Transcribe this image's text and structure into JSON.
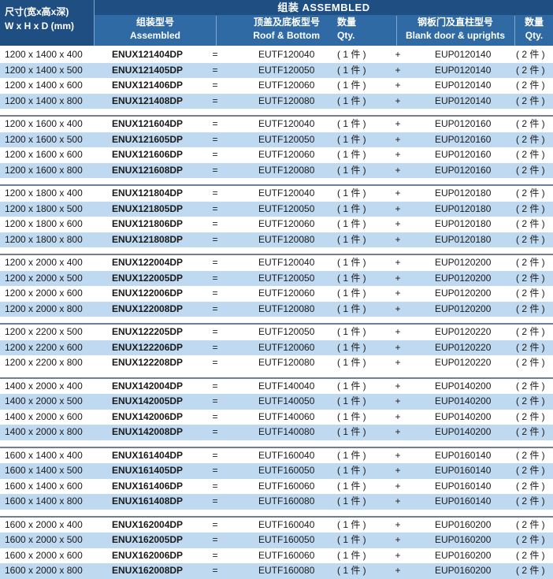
{
  "header": {
    "size_zh": "尺寸(宽x高x深)",
    "size_en": "W x H x D (mm)",
    "assembled": "组装  ASSEMBLED",
    "model_zh": "组装型号",
    "model_en": "Assembled",
    "roof_zh": "顶盖及底板型号",
    "roof_en": "Roof & Bottom",
    "qty1_zh": "数量",
    "qty1_en": "Qty.",
    "blank_zh": "钢板门及直柱型号",
    "blank_en": "Blank door & uprights",
    "qty2_zh": "数量",
    "qty2_en": "Qty."
  },
  "symbols": {
    "equals": "=",
    "plus": "+",
    "qty_one": "( 1 件 )",
    "qty_two": "( 2 件 )"
  },
  "colors": {
    "header_dark": "#1f4f82",
    "header_light": "#2f6aa5",
    "row_alt": "#bfd9f0",
    "group_rule": "#6f7f91"
  },
  "groups": [
    [
      {
        "size": "1200 x 1400 x 400",
        "model": "ENUX121404DP",
        "roof": "EUTF120040",
        "blank": "EUP0120140"
      },
      {
        "size": "1200 x 1400 x 500",
        "model": "ENUX121405DP",
        "roof": "EUTF120050",
        "blank": "EUP0120140"
      },
      {
        "size": "1200 x 1400 x 600",
        "model": "ENUX121406DP",
        "roof": "EUTF120060",
        "blank": "EUP0120140"
      },
      {
        "size": "1200 x 1400 x 800",
        "model": "ENUX121408DP",
        "roof": "EUTF120080",
        "blank": "EUP0120140"
      }
    ],
    [
      {
        "size": "1200 x 1600 x 400",
        "model": "ENUX121604DP",
        "roof": "EUTF120040",
        "blank": "EUP0120160"
      },
      {
        "size": "1200 x 1600 x 500",
        "model": "ENUX121605DP",
        "roof": "EUTF120050",
        "blank": "EUP0120160"
      },
      {
        "size": "1200 x 1600 x 600",
        "model": "ENUX121606DP",
        "roof": "EUTF120060",
        "blank": "EUP0120160"
      },
      {
        "size": "1200 x 1600 x 800",
        "model": "ENUX121608DP",
        "roof": "EUTF120080",
        "blank": "EUP0120160"
      }
    ],
    [
      {
        "size": "1200 x 1800 x 400",
        "model": "ENUX121804DP",
        "roof": "EUTF120040",
        "blank": "EUP0120180"
      },
      {
        "size": "1200 x 1800 x 500",
        "model": "ENUX121805DP",
        "roof": "EUTF120050",
        "blank": "EUP0120180"
      },
      {
        "size": "1200 x 1800 x 600",
        "model": "ENUX121806DP",
        "roof": "EUTF120060",
        "blank": "EUP0120180"
      },
      {
        "size": "1200 x 1800 x 800",
        "model": "ENUX121808DP",
        "roof": "EUTF120080",
        "blank": "EUP0120180"
      }
    ],
    [
      {
        "size": "1200 x 2000 x 400",
        "model": "ENUX122004DP",
        "roof": "EUTF120040",
        "blank": "EUP0120200"
      },
      {
        "size": "1200 x 2000 x 500",
        "model": "ENUX122005DP",
        "roof": "EUTF120050",
        "blank": "EUP0120200"
      },
      {
        "size": "1200 x 2000 x 600",
        "model": "ENUX122006DP",
        "roof": "EUTF120060",
        "blank": "EUP0120200"
      },
      {
        "size": "1200 x 2000 x 800",
        "model": "ENUX122008DP",
        "roof": "EUTF120080",
        "blank": "EUP0120200"
      }
    ],
    [
      {
        "size": "1200 x 2200 x 500",
        "model": "ENUX122205DP",
        "roof": "EUTF120050",
        "blank": "EUP0120220"
      },
      {
        "size": "1200 x 2200 x 600",
        "model": "ENUX122206DP",
        "roof": "EUTF120060",
        "blank": "EUP0120220"
      },
      {
        "size": "1200 x 2200 x 800",
        "model": "ENUX122208DP",
        "roof": "EUTF120080",
        "blank": "EUP0120220"
      }
    ],
    [
      {
        "size": "1400 x 2000 x 400",
        "model": "ENUX142004DP",
        "roof": "EUTF140040",
        "blank": "EUP0140200"
      },
      {
        "size": "1400 x 2000 x 500",
        "model": "ENUX142005DP",
        "roof": "EUTF140050",
        "blank": "EUP0140200"
      },
      {
        "size": "1400 x 2000 x 600",
        "model": "ENUX142006DP",
        "roof": "EUTF140060",
        "blank": "EUP0140200"
      },
      {
        "size": "1400 x 2000 x 800",
        "model": "ENUX142008DP",
        "roof": "EUTF140080",
        "blank": "EUP0140200"
      }
    ],
    [
      {
        "size": "1600 x 1400 x 400",
        "model": "ENUX161404DP",
        "roof": "EUTF160040",
        "blank": "EUP0160140"
      },
      {
        "size": "1600 x 1400 x 500",
        "model": "ENUX161405DP",
        "roof": "EUTF160050",
        "blank": "EUP0160140"
      },
      {
        "size": "1600 x 1400 x 600",
        "model": "ENUX161406DP",
        "roof": "EUTF160060",
        "blank": "EUP0160140"
      },
      {
        "size": "1600 x 1400 x 800",
        "model": "ENUX161408DP",
        "roof": "EUTF160080",
        "blank": "EUP0160140"
      }
    ],
    [
      {
        "size": "1600 x 2000 x 400",
        "model": "ENUX162004DP",
        "roof": "EUTF160040",
        "blank": "EUP0160200"
      },
      {
        "size": "1600 x 2000 x 500",
        "model": "ENUX162005DP",
        "roof": "EUTF160050",
        "blank": "EUP0160200"
      },
      {
        "size": "1600 x 2000 x 600",
        "model": "ENUX162006DP",
        "roof": "EUTF160060",
        "blank": "EUP0160200"
      },
      {
        "size": "1600 x 2000 x 800",
        "model": "ENUX162008DP",
        "roof": "EUTF160080",
        "blank": "EUP0160200"
      }
    ]
  ]
}
